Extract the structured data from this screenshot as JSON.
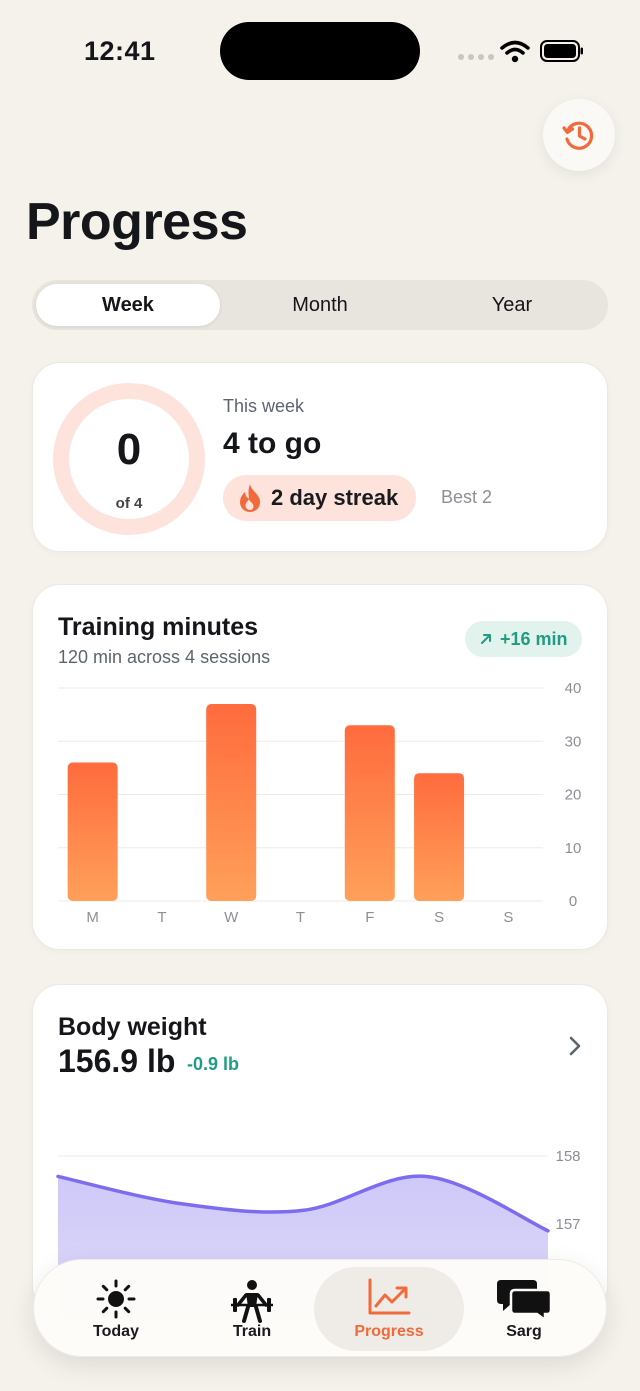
{
  "status": {
    "time": "12:41"
  },
  "header": {
    "title": "Progress",
    "history_icon": "history-icon"
  },
  "range_tabs": [
    {
      "label": "Week",
      "selected": true
    },
    {
      "label": "Month",
      "selected": false
    },
    {
      "label": "Year",
      "selected": false
    }
  ],
  "weekly_goal": {
    "done": "0",
    "of_label": "of 4",
    "progress_fraction": 0,
    "period_label": "This week",
    "remaining_label": "4 to go",
    "streak_label": "2 day streak",
    "streak_icon": "flame-icon",
    "best_label": "Best 2"
  },
  "training": {
    "title": "Training minutes",
    "subtitle": "120 min across 4 sessions",
    "delta_label": "+16 min"
  },
  "body_weight": {
    "title": "Body weight",
    "value": "156.9 lb",
    "delta": "-0.9 lb"
  },
  "chart_data": [
    {
      "type": "bar",
      "title": "Training minutes",
      "categories": [
        "M",
        "T",
        "W",
        "T",
        "F",
        "S",
        "S"
      ],
      "values": [
        26,
        0,
        37,
        0,
        33,
        24,
        0
      ],
      "ylim": [
        0,
        40
      ],
      "yticks": [
        "0",
        "10",
        "20",
        "30",
        "40"
      ],
      "grid": true,
      "bar_color": "#ff6b3d"
    },
    {
      "type": "area",
      "title": "Body weight",
      "x": [
        0,
        1,
        2,
        3,
        4
      ],
      "y": [
        157.7,
        157.3,
        157.2,
        157.7,
        156.9
      ],
      "yticks": [
        "157",
        "158"
      ],
      "grid": true,
      "line_color": "#7b6cf0"
    }
  ],
  "colors": {
    "accent": "#f06a3b",
    "positive": "#1f9c82",
    "background": "#f5f2ec"
  },
  "tabbar": [
    {
      "label": "Today",
      "icon": "sun-icon",
      "active": false
    },
    {
      "label": "Train",
      "icon": "barbell-icon",
      "active": false
    },
    {
      "label": "Progress",
      "icon": "trend-chart-icon",
      "active": true
    },
    {
      "label": "Sarg",
      "icon": "chat-bubbles-icon",
      "active": false
    }
  ]
}
